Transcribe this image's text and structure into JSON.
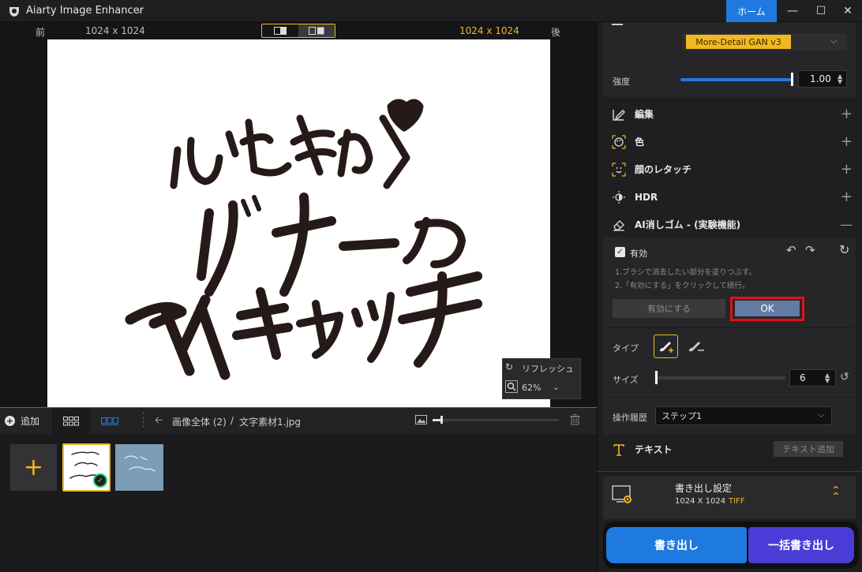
{
  "app": {
    "title": "Aiarty Image Enhancer",
    "home_label": "ホーム"
  },
  "compare": {
    "before_label": "前",
    "before_size": "1024 x 1024",
    "after_size": "1024 x 1024",
    "after_label": "後"
  },
  "canvas": {
    "refresh_label": "リフレッシュ",
    "zoom": "62%"
  },
  "filmstrip": {
    "add_label": "追加",
    "breadcrumb_all": "画像全体 (2)",
    "breadcrumb_sep": "/",
    "breadcrumb_file": "文字素材1.jpg"
  },
  "panel": {
    "model": "More-Detail GAN  v3",
    "strength_label": "強度",
    "strength_value": "1.00",
    "sections": {
      "edit": "編集",
      "color": "色",
      "face": "顔のレタッチ",
      "hdr": "HDR",
      "eraser": "AI消しゴム - (実験機能)"
    },
    "eraser": {
      "enabled_label": "有効",
      "hint1": "1.ブラシで消去したい部分を塗りつぶす。",
      "hint2": "2.「有効にする」をクリックして続行。",
      "apply_label": "有効にする",
      "ok_label": "OK",
      "type_label": "タイプ",
      "size_label": "サイズ",
      "size_value": "6",
      "history_label": "操作履歴",
      "history_value": "ステップ1"
    },
    "text": {
      "label": "テキスト",
      "add_label": "テキスト追加"
    },
    "export_settings": {
      "title": "書き出し設定",
      "size": "1024 X 1024",
      "format": "TIFF"
    },
    "export_label": "書き出し",
    "batch_export_label": "一括書き出し"
  },
  "colors": {
    "accent": "#f2b822",
    "primary": "#1f7ae0",
    "batch": "#4a3cd6",
    "highlight": "#e2101a"
  }
}
